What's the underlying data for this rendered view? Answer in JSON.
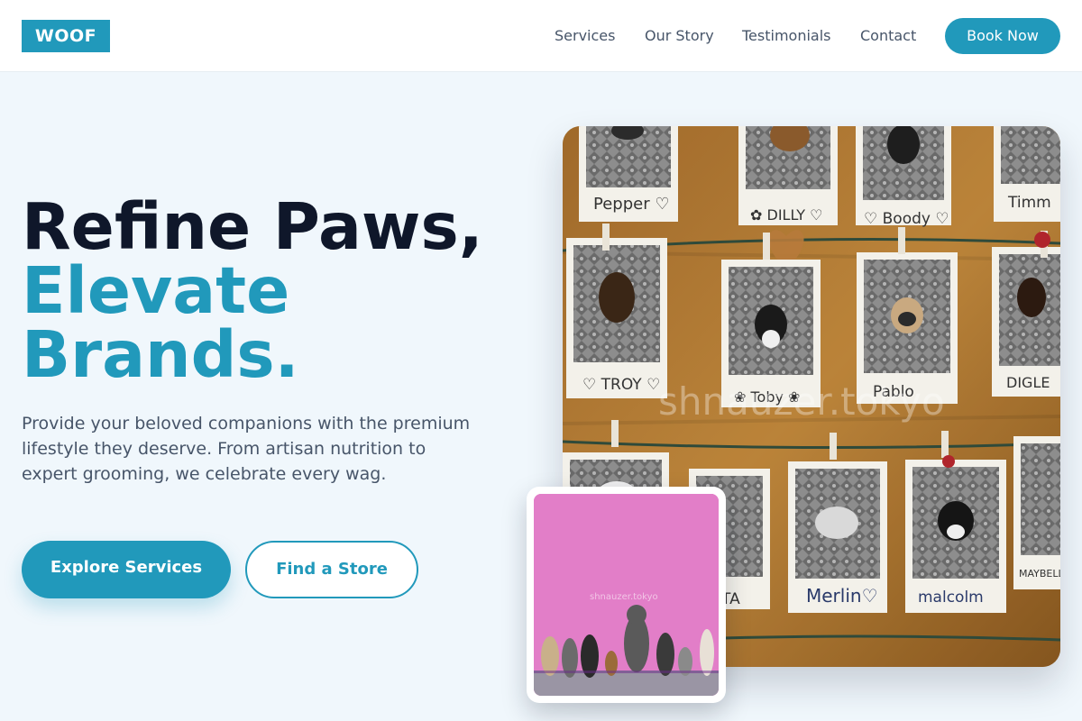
{
  "header": {
    "logo": "WOOF",
    "nav": [
      "Services",
      "Our Story",
      "Testimonials",
      "Contact"
    ],
    "cta": "Book Now"
  },
  "hero": {
    "headline_line1": "Refine Paws,",
    "headline_line2": "Elevate",
    "headline_line3": "Brands.",
    "description": "Provide your beloved companions with the premium lifestyle they deserve. From artisan nutrition to expert grooming, we celebrate every wag.",
    "primary_button": "Explore Services",
    "secondary_button": "Find a Store"
  },
  "images": {
    "main_watermark": "shnauzer.tokyo",
    "inset_watermark": "shnauzer.tokyo",
    "polaroid_labels": [
      "Pepper",
      "DILLY",
      "Boody",
      "Timm",
      "TROY",
      "Toby",
      "Pablo",
      "DIGLE",
      "TA",
      "Merlin",
      "malcolm",
      "MAYBELLE A"
    ]
  },
  "colors": {
    "accent": "#2199bb",
    "dark": "#0f172a",
    "text_muted": "#475569",
    "background": "#f0f7fc"
  }
}
